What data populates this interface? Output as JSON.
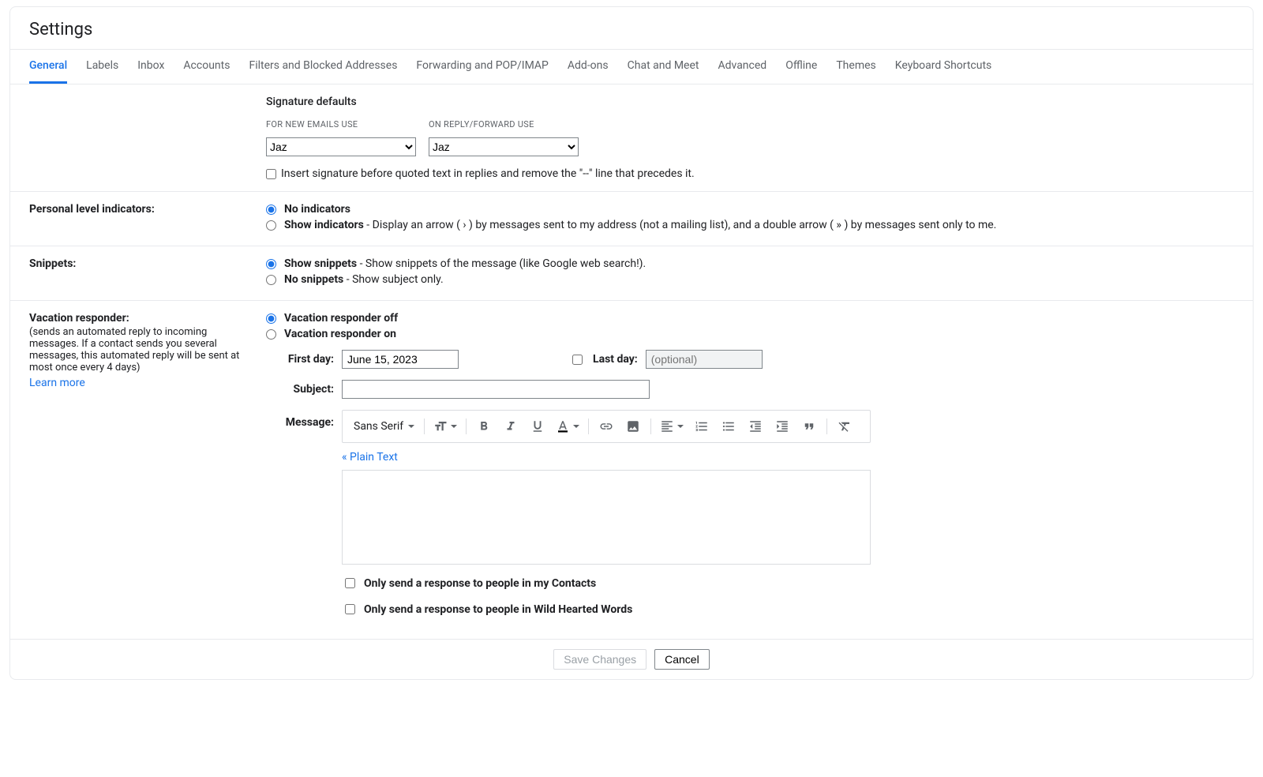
{
  "page_title": "Settings",
  "tabs": [
    "General",
    "Labels",
    "Inbox",
    "Accounts",
    "Filters and Blocked Addresses",
    "Forwarding and POP/IMAP",
    "Add-ons",
    "Chat and Meet",
    "Advanced",
    "Offline",
    "Themes",
    "Keyboard Shortcuts"
  ],
  "active_tab_index": 0,
  "signature_defaults": {
    "title": "Signature defaults",
    "new_emails_label": "FOR NEW EMAILS USE",
    "reply_forward_label": "ON REPLY/FORWARD USE",
    "new_emails_value": "Jaz",
    "reply_forward_value": "Jaz",
    "insert_checkbox_label": "Insert signature before quoted text in replies and remove the \"--\" line that precedes it."
  },
  "personal_level": {
    "title": "Personal level indicators:",
    "no_indicators": "No indicators",
    "show_indicators_bold": "Show indicators",
    "show_indicators_desc": " - Display an arrow ( › ) by messages sent to my address (not a mailing list), and a double arrow ( » ) by messages sent only to me."
  },
  "snippets": {
    "title": "Snippets:",
    "show_bold": "Show snippets",
    "show_desc": " - Show snippets of the message (like Google web search!).",
    "no_bold": "No snippets",
    "no_desc": " - Show subject only."
  },
  "vacation": {
    "title": "Vacation responder:",
    "desc": "(sends an automated reply to incoming messages. If a contact sends you several messages, this automated reply will be sent at most once every 4 days)",
    "learn_more": "Learn more",
    "off": "Vacation responder off",
    "on": "Vacation responder on",
    "first_day_label": "First day:",
    "first_day_value": "June 15, 2023",
    "last_day_label": "Last day:",
    "last_day_placeholder": "(optional)",
    "subject_label": "Subject:",
    "message_label": "Message:",
    "font_label": "Sans Serif",
    "plain_text": "« Plain Text",
    "contacts_only": "Only send a response to people in my Contacts",
    "domain_only": "Only send a response to people in Wild Hearted Words"
  },
  "footer": {
    "save": "Save Changes",
    "cancel": "Cancel"
  }
}
